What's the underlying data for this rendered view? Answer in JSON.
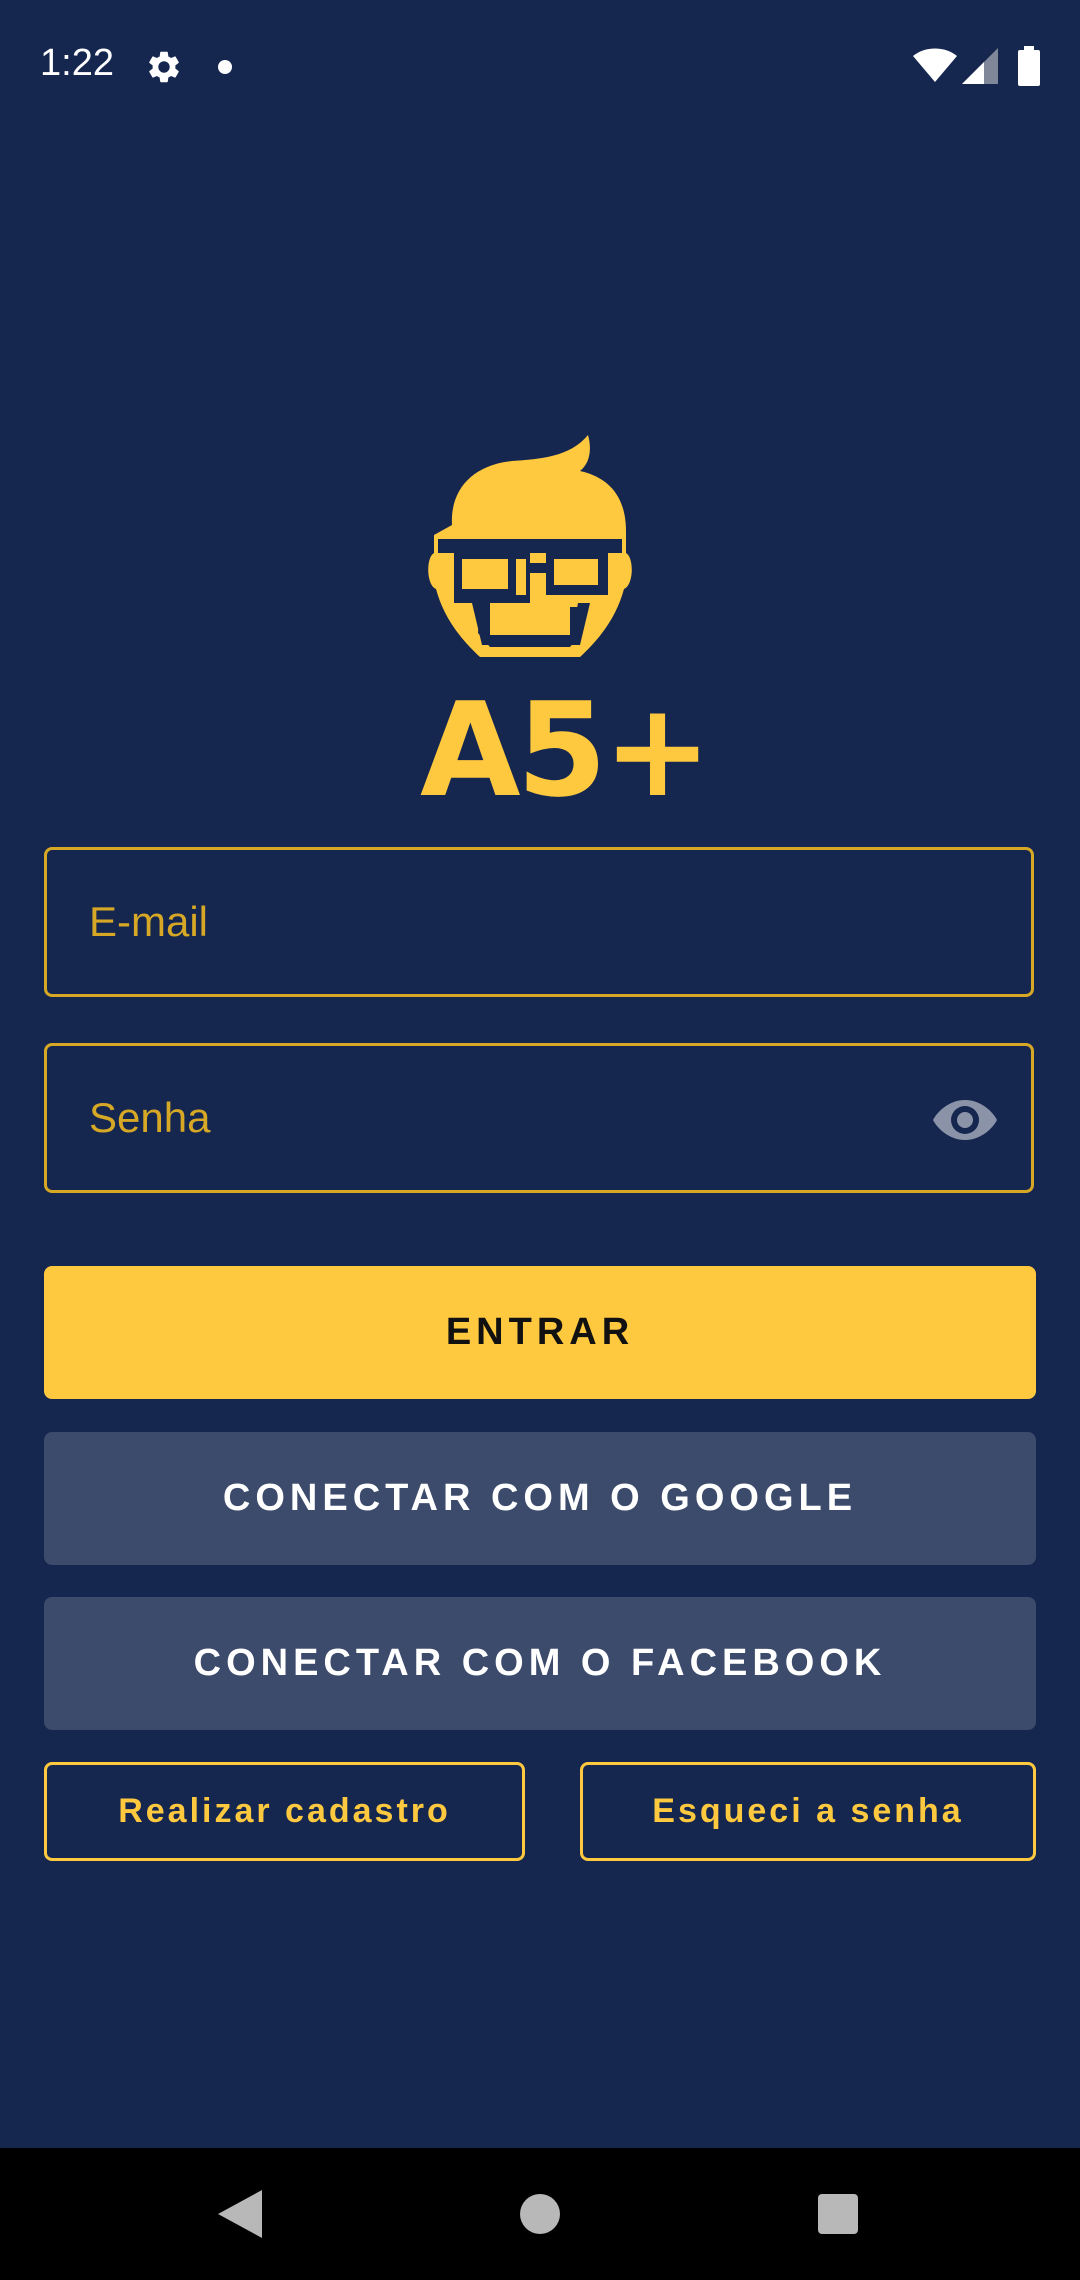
{
  "status_bar": {
    "time": "1:22",
    "icons": [
      "gear-icon",
      "notification-dot-icon",
      "wifi-icon",
      "cell-signal-icon",
      "battery-icon"
    ]
  },
  "logo": {
    "text": "A5+",
    "icon": "nerd-glasses-face-icon"
  },
  "form": {
    "email_placeholder": "E-mail",
    "email_value": "",
    "password_placeholder": "Senha",
    "password_value": "",
    "password_toggle_icon": "eye-icon"
  },
  "actions": {
    "login_label": "ENTRAR",
    "google_label": "CONECTAR COM O GOOGLE",
    "facebook_label": "CONECTAR COM O FACEBOOK",
    "register_label": "Realizar cadastro",
    "forgot_label": "Esqueci a senha"
  },
  "nav_bar": {
    "icons": [
      "back-icon",
      "home-icon",
      "recents-icon"
    ]
  },
  "colors": {
    "background": "#15264f",
    "accent": "#fec83f",
    "secondary_button": "#3c4a6b",
    "field_border": "#d6a826"
  }
}
